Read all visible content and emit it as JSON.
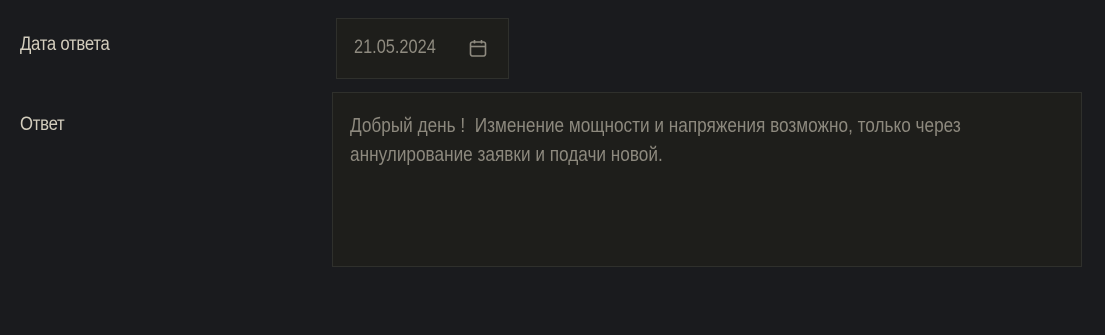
{
  "form": {
    "date_label": "Дата ответа",
    "date_value": "21.05.2024",
    "date_icon": "calendar-icon",
    "answer_label": "Ответ",
    "answer_text": "Добрый день !  Изменение мощности и напряжения возможно, только через\nаннулирование заявки и подачи новой."
  },
  "colors": {
    "background": "#1a1b1e",
    "field_background": "#1e1e1b",
    "field_border": "#2f302c",
    "label_text": "#d3cdbd",
    "value_text": "#8f8b80"
  }
}
